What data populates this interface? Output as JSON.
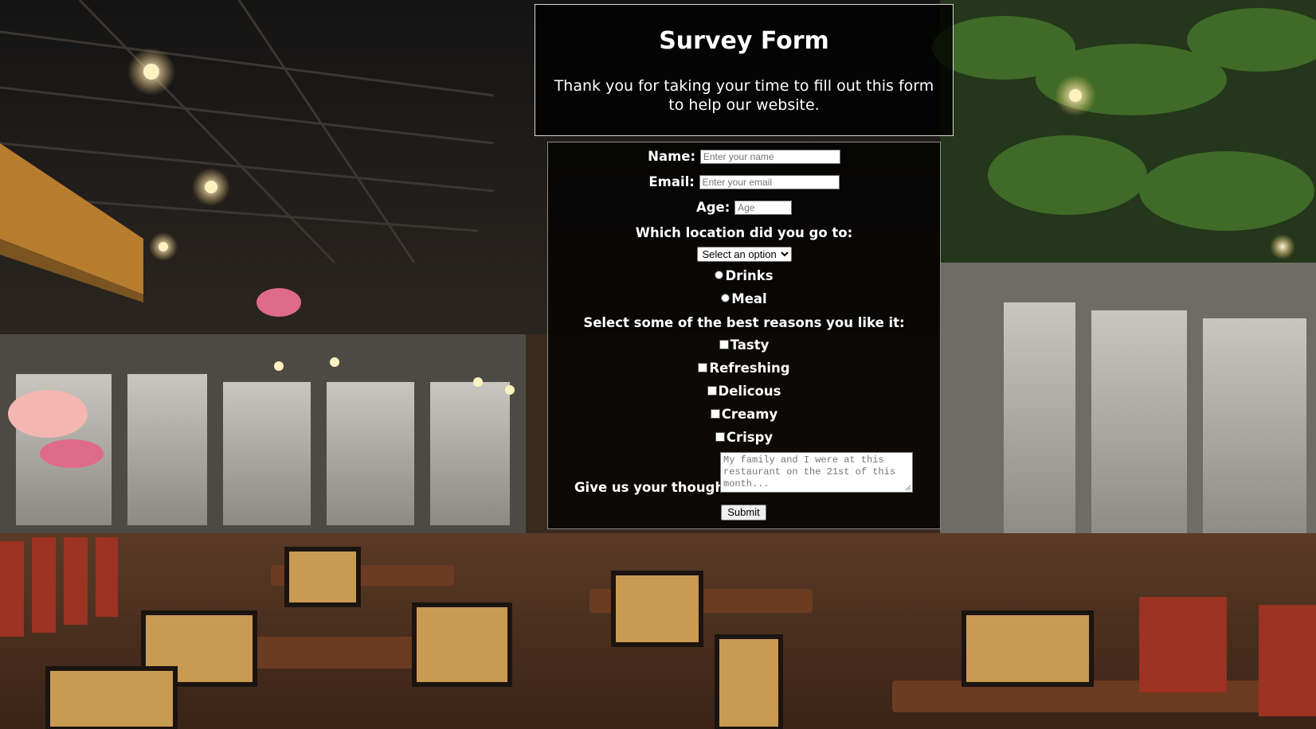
{
  "header": {
    "title": "Survey Form",
    "description": "Thank you for taking your time to fill out this form to help our website."
  },
  "form": {
    "name": {
      "label": "Name:",
      "placeholder": "Enter your name",
      "value": ""
    },
    "email": {
      "label": "Email:",
      "placeholder": "Enter your email",
      "value": ""
    },
    "age": {
      "label": "Age:",
      "placeholder": "Age",
      "value": ""
    },
    "location": {
      "label": "Which location did you go to:",
      "selected": "Select an option"
    },
    "visit_type": {
      "options": [
        "Drinks",
        "Meal"
      ]
    },
    "reasons": {
      "label": "Select some of the best reasons you like it:",
      "options": [
        "Tasty",
        "Refreshing",
        "Delicous",
        "Creamy",
        "Crispy"
      ]
    },
    "thoughts": {
      "label": "Give us your thoughts:",
      "placeholder": "My family and I were at this restaurant on the 21st of this month..."
    },
    "submit_label": "Submit"
  },
  "colors": {
    "panel_background": "#000000",
    "text": "#ffffff",
    "header_border": "#d8d8d8"
  }
}
